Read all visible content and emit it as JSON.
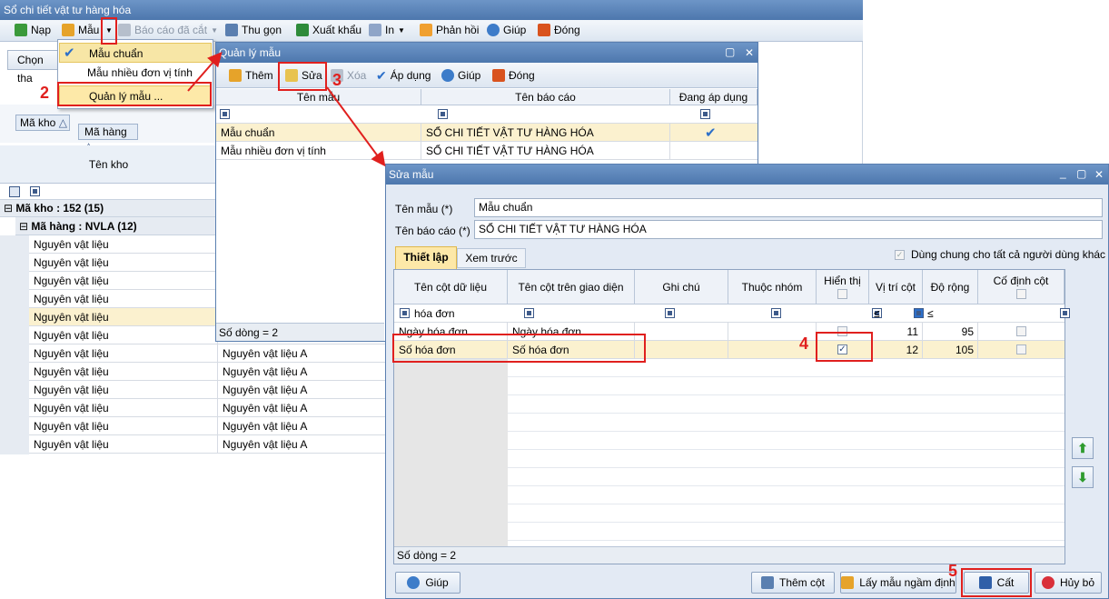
{
  "main": {
    "title": "Sổ chi tiết vật tư hàng hóa",
    "toolbar": {
      "reload": "Nạp",
      "template": "Mẫu",
      "saved_report": "Báo cáo đã cắt",
      "collapse": "Thu gọn",
      "export": "Xuất khẩu",
      "print": "In",
      "feedback": "Phản hồi",
      "help": "Giúp",
      "close": "Đóng"
    },
    "choose_btn": "Chọn tha",
    "group_warehouse": "Mã kho",
    "group_item": "Mã hàng",
    "col_warehouse": "Tên kho",
    "group_row1": "Mã kho : 152 (15)",
    "group_row2": "Mã hàng : NVLA (12)",
    "rows": [
      "Nguyên vật liệu",
      "Nguyên vật liệu",
      "Nguyên vật liệu",
      "Nguyên vật liệu",
      "Nguyên vật liệu",
      "Nguyên vật liệu",
      "Nguyên vật liệu",
      "Nguyên vật liệu",
      "Nguyên vật liệu",
      "Nguyên vật liệu",
      "Nguyên vật liệu",
      "Nguyên vật liệu"
    ],
    "col2_rows": [
      "Nguyên vật liệu A",
      "Nguyên vật liệu A",
      "Nguyên vật liệu A",
      "Nguyên vật liệu A",
      "Nguyên vật liệu A",
      "Nguyên vật liệu A",
      "Nguyên vật liệu A"
    ]
  },
  "menu": {
    "items": [
      "Mẫu chuẩn",
      "Mẫu nhiều đơn vị tính",
      "Quản lý mẫu ..."
    ]
  },
  "manage": {
    "title": "Quản lý mẫu",
    "toolbar": {
      "add": "Thêm",
      "edit": "Sửa",
      "delete": "Xóa",
      "apply": "Áp dụng",
      "help": "Giúp",
      "close": "Đóng"
    },
    "headers": [
      "Tên mẫu",
      "Tên báo cáo",
      "Đang áp dụng"
    ],
    "rows": [
      {
        "name": "Mẫu chuẩn",
        "report": "SỔ CHI TIẾT VẬT TƯ HÀNG HÓA"
      },
      {
        "name": "Mẫu nhiều đơn vị tính",
        "report": "SỔ CHI TIẾT VẬT TƯ HÀNG HÓA"
      }
    ],
    "footer": "Số dòng = 2"
  },
  "edit": {
    "title": "Sửa mẫu",
    "name_label": "Tên mẫu (*)",
    "name_value": "Mẫu chuẩn",
    "report_label": "Tên báo cáo (*)",
    "report_value": "SỔ CHI TIẾT VẬT TƯ HÀNG HÓA",
    "tabs": [
      "Thiết lập",
      "Xem trước"
    ],
    "share_label": "Dùng chung cho tất cả người dùng khác",
    "headers": [
      "Tên cột dữ liệu",
      "Tên cột trên giao diện",
      "Ghi chú",
      "Thuộc nhóm",
      "Hiển thị",
      "Vị trí cột",
      "Độ rộng",
      "Cố định cột"
    ],
    "filter_text": "hóa đơn",
    "le": "≤",
    "rows": [
      {
        "col": "Ngày hóa đơn",
        "ui": "Ngày hóa đơn",
        "pos": "11",
        "width": "95"
      },
      {
        "col": "Số hóa đơn",
        "ui": "Số hóa đơn",
        "pos": "12",
        "width": "105"
      }
    ],
    "footer": "Số dòng = 2",
    "buttons": {
      "help": "Giúp",
      "add_col": "Thêm cột",
      "default": "Lấy mẫu ngầm định",
      "save": "Cất",
      "cancel": "Hủy bỏ"
    }
  },
  "steps": [
    "2",
    "3",
    "4",
    "5"
  ]
}
